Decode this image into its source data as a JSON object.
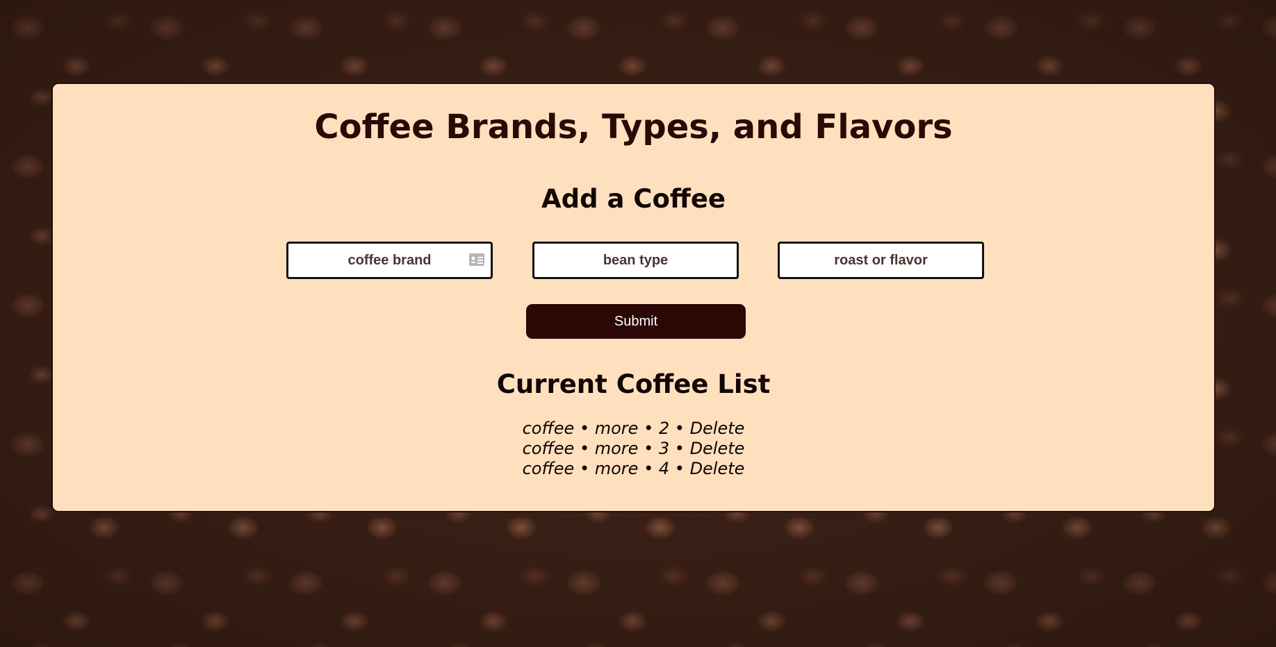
{
  "page": {
    "title": "Coffee Brands, Types, and Flavors"
  },
  "form": {
    "heading": "Add a Coffee",
    "brand_placeholder": "coffee brand",
    "type_placeholder": "bean type",
    "flavor_placeholder": "roast or flavor",
    "submit_label": "Submit"
  },
  "list": {
    "heading": "Current Coffee List",
    "separator": " • ",
    "items": [
      {
        "brand": "coffee",
        "type": "more",
        "flavor": "2",
        "delete_label": "Delete"
      },
      {
        "brand": "coffee",
        "type": "more",
        "flavor": "3",
        "delete_label": "Delete"
      },
      {
        "brand": "coffee",
        "type": "more",
        "flavor": "4",
        "delete_label": "Delete"
      }
    ]
  },
  "icons": {
    "autofill": "contact-card-icon"
  },
  "colors": {
    "card_background": "#fee0bf",
    "title_text": "#2a0a06",
    "submit_background": "#2b0806",
    "submit_text": "#ffffff"
  }
}
